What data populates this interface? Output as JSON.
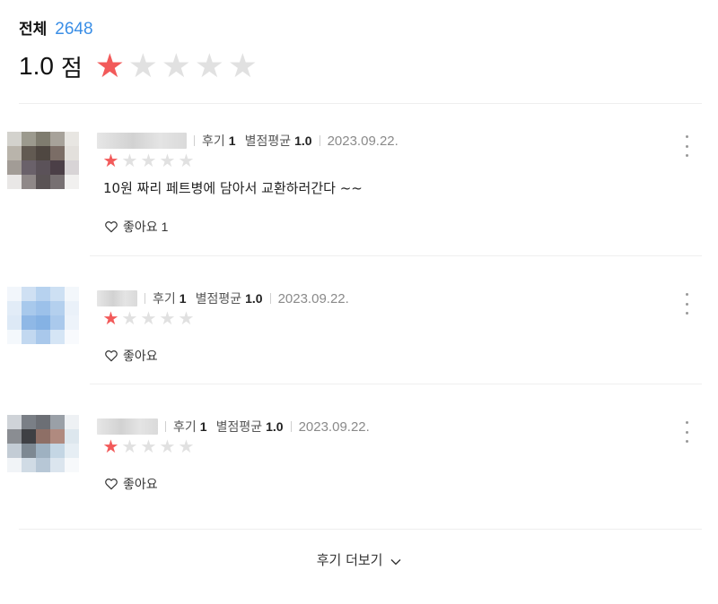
{
  "summary": {
    "total_label": "전체",
    "total_count": "2648",
    "average_score": "1.0",
    "score_unit": "점",
    "average_rating": 1,
    "max_rating": 5
  },
  "colors": {
    "star_on": "#f25a5a",
    "star_off": "#e1e1e1",
    "count_accent": "#3a8ee6"
  },
  "reviews": [
    {
      "review_count_label": "후기",
      "review_count": "1",
      "avg_label": "별점평균",
      "avg_value": "1.0",
      "date": "2023.09.22.",
      "rating": 1,
      "content": "10원 짜리 페트병에 담아서 교환하러간다 ~~",
      "like_label": "좋아요",
      "like_count": "1"
    },
    {
      "review_count_label": "후기",
      "review_count": "1",
      "avg_label": "별점평균",
      "avg_value": "1.0",
      "date": "2023.09.22.",
      "rating": 1,
      "content": "",
      "like_label": "좋아요",
      "like_count": ""
    },
    {
      "review_count_label": "후기",
      "review_count": "1",
      "avg_label": "별점평균",
      "avg_value": "1.0",
      "date": "2023.09.22.",
      "rating": 1,
      "content": "",
      "like_label": "좋아요",
      "like_count": ""
    }
  ],
  "load_more_label": "후기 더보기"
}
